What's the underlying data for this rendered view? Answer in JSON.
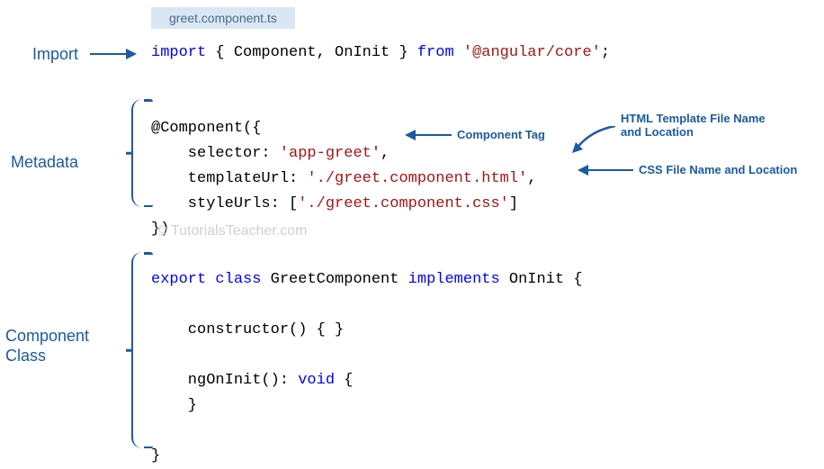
{
  "filename": "greet.component.ts",
  "labels": {
    "import": "Import",
    "metadata": "Metadata",
    "class_line1": "Component",
    "class_line2": "Class"
  },
  "annotations": {
    "component_tag": "Component Tag",
    "html_line1": "HTML Template File Name",
    "html_line2": "and Location",
    "css": "CSS File Name and Location"
  },
  "watermark": "© TutorialsTeacher.com",
  "code": {
    "import_kw": "import",
    "import_body": " { Component, OnInit } ",
    "from_kw": "from",
    "from_str": "'@angular/core'",
    "import_end": ";",
    "decorator": "@Component({",
    "selector_label": "    selector: ",
    "selector_val": "'app-greet'",
    "selector_end": ",",
    "template_label": "    templateUrl: ",
    "template_val": "'./greet.component.html'",
    "template_end": ",",
    "style_label": "    styleUrls: [",
    "style_val": "'./greet.component.css'",
    "style_end": "]",
    "decorator_end": "})",
    "export_kw": "export",
    "class_kw": "class",
    "class_name": " GreetComponent ",
    "implements_kw": "implements",
    "implements_name": " OnInit {",
    "constructor": "    constructor() { }",
    "nginit": "    ngOnInit(): ",
    "void_kw": "void",
    "nginit_end": " {",
    "brace_close1": "    }",
    "brace_close2": "}"
  }
}
